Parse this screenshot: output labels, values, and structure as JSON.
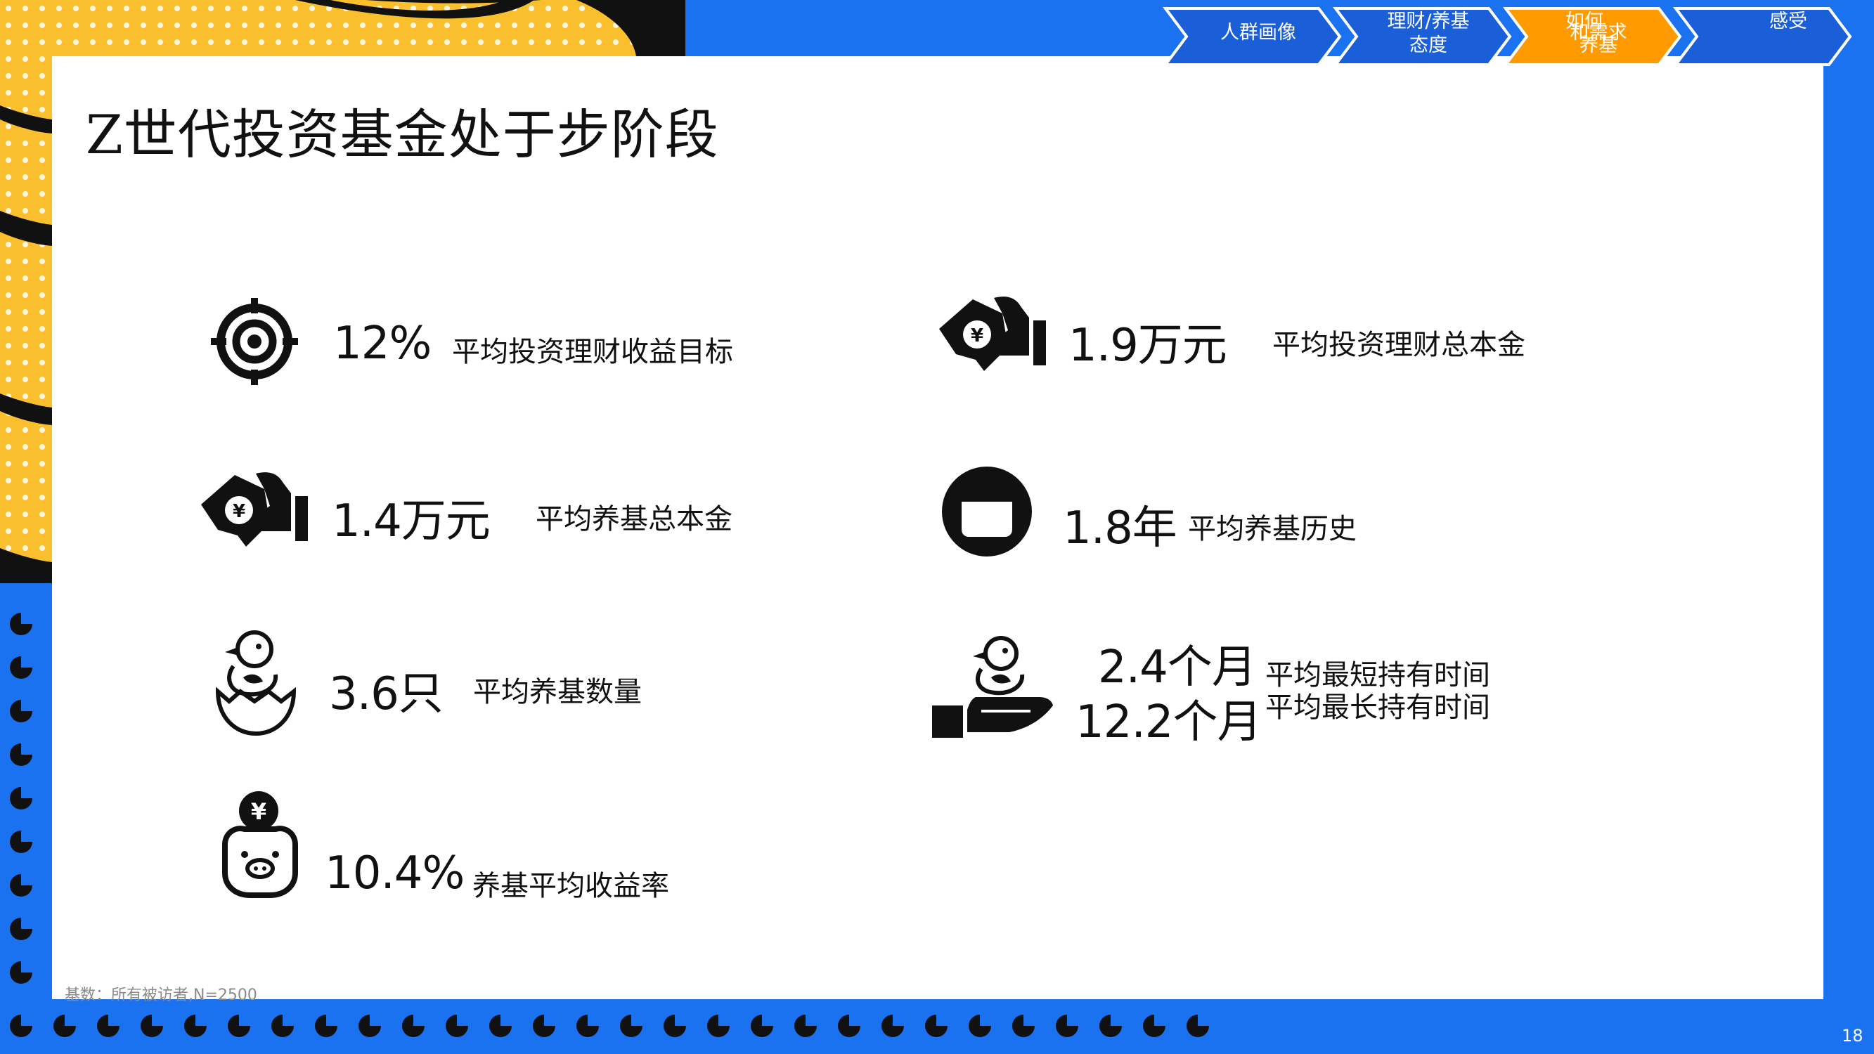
{
  "nav": {
    "items": [
      {
        "label": "人群画像",
        "active": false
      },
      {
        "label_line1": "理财/养基",
        "label_line2": "态度",
        "active": false
      },
      {
        "label_line1": "如何",
        "label_line2": "养基",
        "overlay": "和需求",
        "active": true
      },
      {
        "label": "感受",
        "active": false
      }
    ]
  },
  "title": "Z世代投资基金处于步阶段",
  "stats": [
    {
      "value": "12%",
      "label": "平均投资理财收益目标",
      "icon": "target-icon"
    },
    {
      "value": "1.9万元",
      "label": "平均投资理财总本金",
      "icon": "money-hand-icon"
    },
    {
      "value": "1.4万元",
      "label": "平均养基总本金",
      "icon": "money-hand-icon"
    },
    {
      "value": "1.8年",
      "label": "平均养基历史",
      "icon": "calendar-icon"
    },
    {
      "value": "3.6只",
      "label": "平均养基数量",
      "icon": "chick-egg-icon"
    },
    {
      "value": "10.4%",
      "label": "养基平均收益率",
      "icon": "piggy-bank-icon"
    },
    {
      "value_short": "2.4个月",
      "label_short": "平均最短持有时间",
      "value_long": "12.2个月",
      "label_long": "平均最长持有时间",
      "icon": "chick-hand-icon"
    }
  ],
  "footnote": "基数：所有被访者,N=2500",
  "page_number": "18",
  "colors": {
    "blue": "#1a72f0",
    "yellow": "#f9bf2c",
    "orange": "#ff9a00",
    "nav_blue": "#1a5fd8",
    "black": "#111111"
  }
}
